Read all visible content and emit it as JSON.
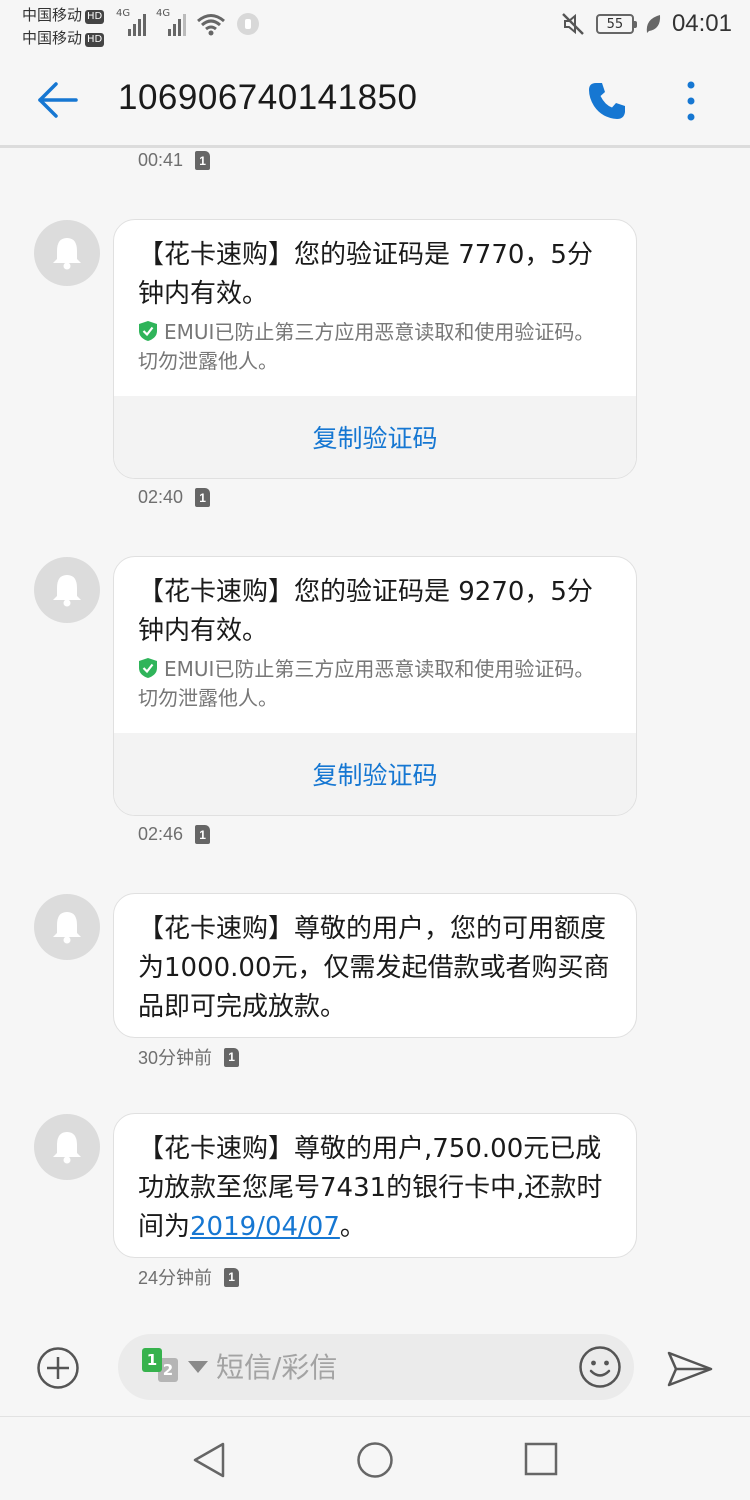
{
  "status_bar": {
    "carrier1": "中国移动",
    "carrier2": "中国移动",
    "hd_label": "HD",
    "network1": "4G",
    "network2": "4G",
    "battery": "55",
    "time": "04:01",
    "icons": [
      "mute-icon",
      "wifi-icon",
      "leaf-icon"
    ]
  },
  "header": {
    "title": "106906740141850",
    "icons": [
      "back-arrow-icon",
      "phone-icon",
      "more-vertical-icon"
    ]
  },
  "messages": [
    {
      "timestamp": "00:41",
      "sim": "1"
    },
    {
      "text": "【花卡速购】您的验证码是 7770，5分钟内有效。",
      "security_note": "EMUI已防止第三方应用恶意读取和使用验证码。切勿泄露他人。",
      "copy_label": "复制验证码",
      "timestamp": "02:40",
      "sim": "1"
    },
    {
      "text": "【花卡速购】您的验证码是 9270，5分钟内有效。",
      "security_note": "EMUI已防止第三方应用恶意读取和使用验证码。切勿泄露他人。",
      "copy_label": "复制验证码",
      "timestamp": "02:46",
      "sim": "1"
    },
    {
      "text": "【花卡速购】尊敬的用户，您的可用额度为1000.00元，仅需发起借款或者购买商品即可完成放款。",
      "timestamp": "30分钟前",
      "sim": "1"
    },
    {
      "text_before": "【花卡速购】尊敬的用户,750.00元已成功放款至您尾号7431的银行卡中,还款时间为",
      "link": "2019/04/07",
      "text_after": "。",
      "timestamp": "24分钟前",
      "sim": "1"
    }
  ],
  "composer": {
    "sim1": "1",
    "sim2": "2",
    "placeholder": "短信/彩信",
    "icons": [
      "add-icon",
      "dropdown-icon",
      "emoji-icon",
      "send-icon"
    ]
  },
  "nav_bar": {
    "icons": [
      "nav-back-icon",
      "nav-home-icon",
      "nav-recent-icon"
    ]
  },
  "colors": {
    "accent": "#1677d2",
    "background": "#f6f6f6",
    "bubble": "#ffffff",
    "shield": "#2fb45a",
    "sim1": "#37b24d"
  }
}
